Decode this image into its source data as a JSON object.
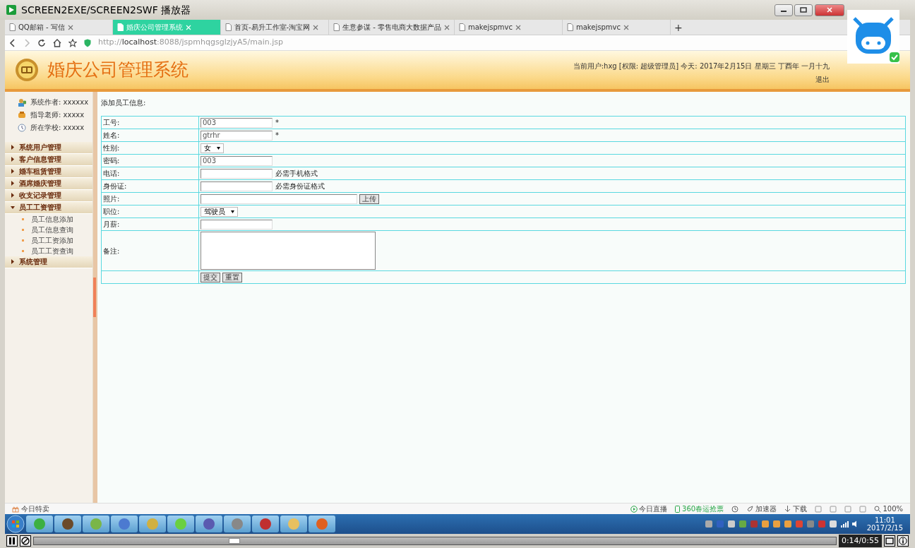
{
  "player": {
    "title": "SCREEN2EXE/SCREEN2SWF 播放器",
    "progress": {
      "level": 0.25
    },
    "time": "0:14/0:55"
  },
  "browser": {
    "tabs": [
      {
        "label": "QQ邮箱 - 写信",
        "selected": false
      },
      {
        "label": "婚庆公司管理系统",
        "selected": true
      },
      {
        "label": "首页-易升工作室-淘宝网",
        "selected": false
      },
      {
        "label": "生意参谋 - 零售电商大数据产品",
        "selected": false
      },
      {
        "label": "makejspmvc",
        "selected": false
      },
      {
        "label": "makejspmvc",
        "selected": false
      }
    ],
    "new_tab": "+",
    "url": "http://**localhost**:8088/jspmhqgsglzjyA5/main.jsp",
    "status_left": "今日特卖",
    "status_right": [
      {
        "kind": "live",
        "label": "今日直播"
      },
      {
        "kind": "ticket",
        "label": "360春运抢票"
      },
      {
        "kind": "history"
      },
      {
        "kind": "speed",
        "label": "加速器"
      },
      {
        "kind": "download",
        "label": "下载"
      },
      {
        "kind": "icon"
      },
      {
        "kind": "icon"
      },
      {
        "kind": "icon"
      },
      {
        "kind": "icon"
      },
      {
        "kind": "zoom",
        "label": "100%"
      }
    ]
  },
  "header": {
    "title": "婚庆公司管理系统",
    "user_info": "当前用户:hxg [权限: 超级管理员] 今天:  2017年2月15日 星期三 丁酉年 一月十九",
    "logout": "退出"
  },
  "sidebar": {
    "info": [
      "系统作者: xxxxxx",
      "指导老师: xxxxx",
      "所在学校: xxxxx"
    ],
    "menu": [
      {
        "label": "系统用户管理",
        "expanded": false
      },
      {
        "label": "客户信息管理",
        "expanded": false
      },
      {
        "label": "婚车租赁管理",
        "expanded": false
      },
      {
        "label": "酒席婚庆管理",
        "expanded": false
      },
      {
        "label": "收支记录管理",
        "expanded": false
      },
      {
        "label": "员工工资管理",
        "expanded": true,
        "children": [
          {
            "label": "员工信息添加"
          },
          {
            "label": "员工信息查询"
          },
          {
            "label": "员工工资添加"
          },
          {
            "label": "员工工资查询"
          }
        ]
      },
      {
        "label": "系统管理",
        "expanded": false
      }
    ]
  },
  "form": {
    "title": "添加员工信息:",
    "rows": [
      {
        "kind": "text",
        "label": "工号:",
        "value": "003",
        "suffix": "*"
      },
      {
        "kind": "text",
        "label": "姓名:",
        "value": "gtrhr",
        "suffix": "*"
      },
      {
        "kind": "select",
        "label": "性别:",
        "value": "女"
      },
      {
        "kind": "text",
        "label": "密码:",
        "value": "003"
      },
      {
        "kind": "text",
        "label": "电话:",
        "suffix": "必需手机格式"
      },
      {
        "kind": "text",
        "label": "身份证:",
        "suffix": "必需身份证格式"
      },
      {
        "kind": "file",
        "label": "照片:",
        "button": "上传"
      },
      {
        "kind": "select",
        "label": "职位:",
        "value": "驾驶员"
      },
      {
        "kind": "text",
        "label": "月薪:"
      },
      {
        "kind": "textarea",
        "label": "备注:"
      },
      {
        "kind": "buttons",
        "buttons": [
          "提交",
          "重置"
        ]
      }
    ]
  },
  "taskbar": {
    "time": "11:01",
    "date": "2017/2/15"
  }
}
